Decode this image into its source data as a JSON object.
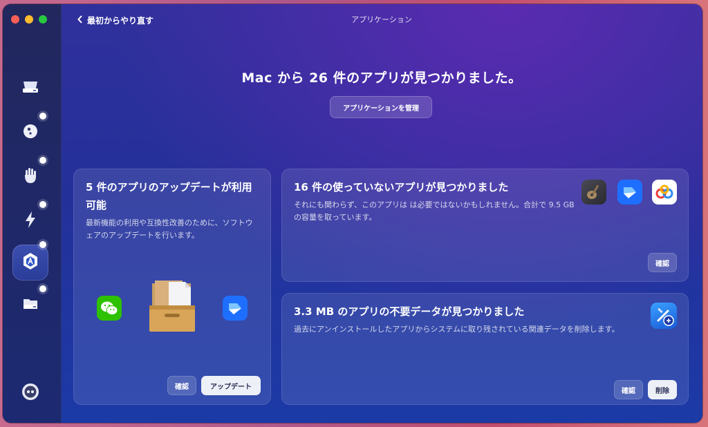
{
  "window": {
    "title": "アプリケーション",
    "back_label": "最初からやり直す"
  },
  "sidebar": {
    "items": [
      {
        "icon": "disk-drive-icon",
        "has_dot": false,
        "active": false
      },
      {
        "icon": "globe-protection-icon",
        "has_dot": true,
        "active": false
      },
      {
        "icon": "hand-stop-icon",
        "has_dot": true,
        "active": false
      },
      {
        "icon": "lightning-icon",
        "has_dot": true,
        "active": false
      },
      {
        "icon": "applications-icon",
        "has_dot": true,
        "active": true
      },
      {
        "icon": "folder-drive-icon",
        "has_dot": true,
        "active": false
      }
    ],
    "assistant_icon": "assistant-face-icon"
  },
  "header": {
    "headline": "Mac から 26 件のアプリが見つかりました。",
    "manage_button": "アプリケーションを管理"
  },
  "cards": {
    "updates": {
      "title": "5 件のアプリのアップデートが利用可能",
      "description": "最新機能の利用や互換性改善のために、ソフトウェアのアップデートを行います。",
      "review_button": "確認",
      "update_button": "アップデート",
      "icons": [
        "wechat-icon",
        "package-box-icon",
        "feishu-icon"
      ]
    },
    "unused": {
      "title": "16 件の使っていないアプリが見つかりました",
      "description": "それにも関わらず、このアプリは は必要ではないかもしれません。合計で 9.5 GB の容量を取っています。",
      "review_button": "確認",
      "icons": [
        "guitar-app-icon",
        "feishu-icon",
        "baidu-netdisk-icon"
      ]
    },
    "leftovers": {
      "title": "3.3 MB のアプリの不要データが見つかりました",
      "description": "過去にアンインストールしたアプリからシステムに取り残されている関連データを削除します。",
      "review_button": "確認",
      "delete_button": "削除",
      "icons": [
        "xcode-leftover-icon"
      ]
    }
  },
  "colors": {
    "accent_dot": "#ffffff",
    "button_light": "#eef0f7",
    "wechat_green": "#2dc100",
    "feishu_blue": "#1e6fff"
  }
}
